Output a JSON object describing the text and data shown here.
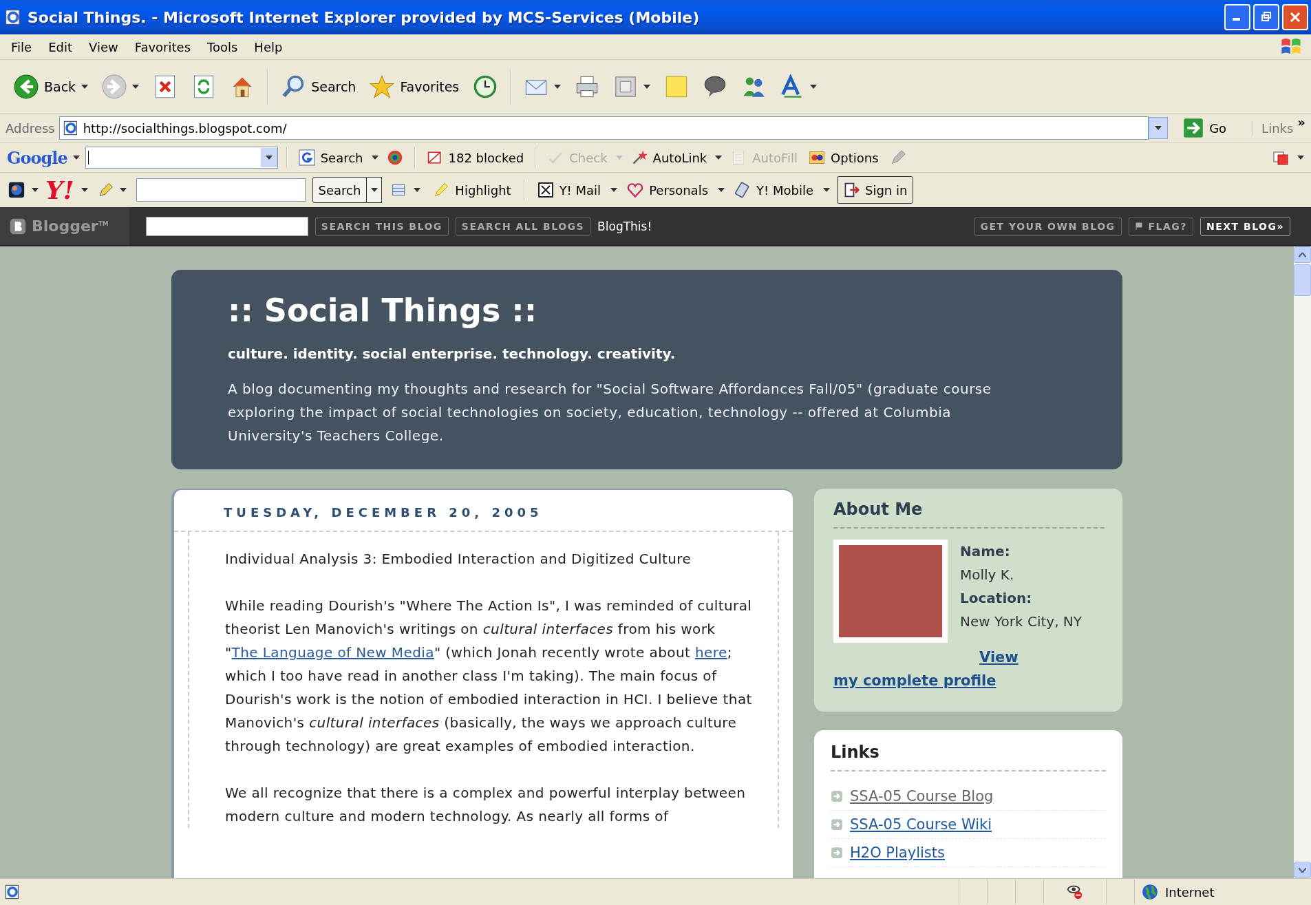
{
  "window": {
    "title": "Social Things. - Microsoft Internet Explorer provided by MCS-Services (Mobile)"
  },
  "menu": [
    "File",
    "Edit",
    "View",
    "Favorites",
    "Tools",
    "Help"
  ],
  "toolbar": [
    {
      "kind": "back",
      "label": "Back",
      "dropdown": true
    },
    {
      "kind": "forward",
      "dropdown": true
    },
    {
      "kind": "stop"
    },
    {
      "kind": "refresh"
    },
    {
      "kind": "home"
    },
    {
      "kind": "separator"
    },
    {
      "kind": "search",
      "label": "Search"
    },
    {
      "kind": "favorites",
      "label": "Favorites"
    },
    {
      "kind": "history"
    },
    {
      "kind": "separator"
    },
    {
      "kind": "mail",
      "dropdown": true
    },
    {
      "kind": "print"
    },
    {
      "kind": "edit",
      "dropdown": true
    },
    {
      "kind": "note"
    },
    {
      "kind": "discuss"
    },
    {
      "kind": "messenger"
    },
    {
      "kind": "font",
      "dropdown": true
    }
  ],
  "address": {
    "label": "Address",
    "value": "http://socialthings.blogspot.com/",
    "go": "Go",
    "links": "Links",
    "more": "»"
  },
  "google_toolbar": {
    "logo": "Google",
    "items": [
      {
        "kind": "search",
        "label": "Search",
        "disabled": false
      },
      {
        "kind": "pagerank",
        "disabled": false
      },
      {
        "kind": "popup",
        "label": "182 blocked",
        "disabled": false
      },
      {
        "kind": "check",
        "label": "Check",
        "disabled": true
      },
      {
        "kind": "autolink",
        "label": "AutoLink",
        "disabled": false
      },
      {
        "kind": "autofill",
        "label": "AutoFill",
        "disabled": true
      },
      {
        "kind": "options",
        "label": "Options",
        "disabled": false
      },
      {
        "kind": "pen",
        "disabled": false
      }
    ]
  },
  "yahoo_toolbar": {
    "logo": "Y!",
    "search": "Search",
    "items": [
      {
        "kind": "highlight",
        "label": "Highlight"
      },
      {
        "kind": "mail",
        "label": "Y! Mail"
      },
      {
        "kind": "personals",
        "label": "Personals"
      },
      {
        "kind": "mobile",
        "label": "Y! Mobile"
      },
      {
        "kind": "signin",
        "label": "Sign in"
      }
    ]
  },
  "blogger_bar": {
    "logo": "Blogger$^{TM}$",
    "left_buttons": [
      "SEARCH THIS BLOG",
      "SEARCH ALL BLOGS"
    ],
    "blogthis": "BlogThis!",
    "right_buttons": [
      "GET YOUR OWN BLOG",
      "FLAG?",
      "NEXT BLOG»"
    ]
  },
  "header": {
    "title": ":: Social Things ::",
    "tagline": "culture. identity. social enterprise. technology. creativity.",
    "description": "A blog documenting my thoughts and research for \"Social Software Affordances Fall/05\" (graduate course exploring the impact of social technologies on society, education, technology -- offered at Columbia University's Teachers College."
  },
  "post": {
    "date": "TUESDAY, DECEMBER 20, 2005",
    "paragraphs": [
      [
        {
          "kind": "text",
          "text": "Individual Analysis 3: Embodied Interaction and Digitized Culture"
        }
      ],
      [
        {
          "kind": "text",
          "text": "While reading Dourish's \"Where The Action Is\", I was reminded of cultural theorist Len Manovich's writings on *cultural interfaces* from his work \""
        },
        {
          "kind": "link",
          "text": "The Language of New Media"
        },
        {
          "kind": "text",
          "text": "\" (which Jonah recently wrote about "
        },
        {
          "kind": "link",
          "text": "here"
        },
        {
          "kind": "text",
          "text": "; which I too have read in another class I'm taking). The main focus of Dourish's work is the notion of embodied interaction in HCI. I believe that Manovich's *cultural interfaces* (basically, the ways we approach culture through technology) are great examples of embodied interaction."
        }
      ],
      [
        {
          "kind": "text",
          "text": "We all recognize that there is a complex and powerful interplay between modern culture and modern technology. As nearly all forms of"
        }
      ]
    ]
  },
  "about": {
    "heading": "About Me",
    "name_label": "Name:",
    "name": "Molly K.",
    "location_label": "Location:",
    "location": "New York City, NY",
    "profile_link": "View my complete profile"
  },
  "links": {
    "heading": "Links",
    "items": [
      {
        "label": "SSA-05 Course Blog",
        "visited": true
      },
      {
        "label": "SSA-05 Course Wiki",
        "visited": false
      },
      {
        "label": "H2O Playlists",
        "visited": false
      }
    ]
  },
  "status_bar": {
    "zone": "Internet"
  }
}
